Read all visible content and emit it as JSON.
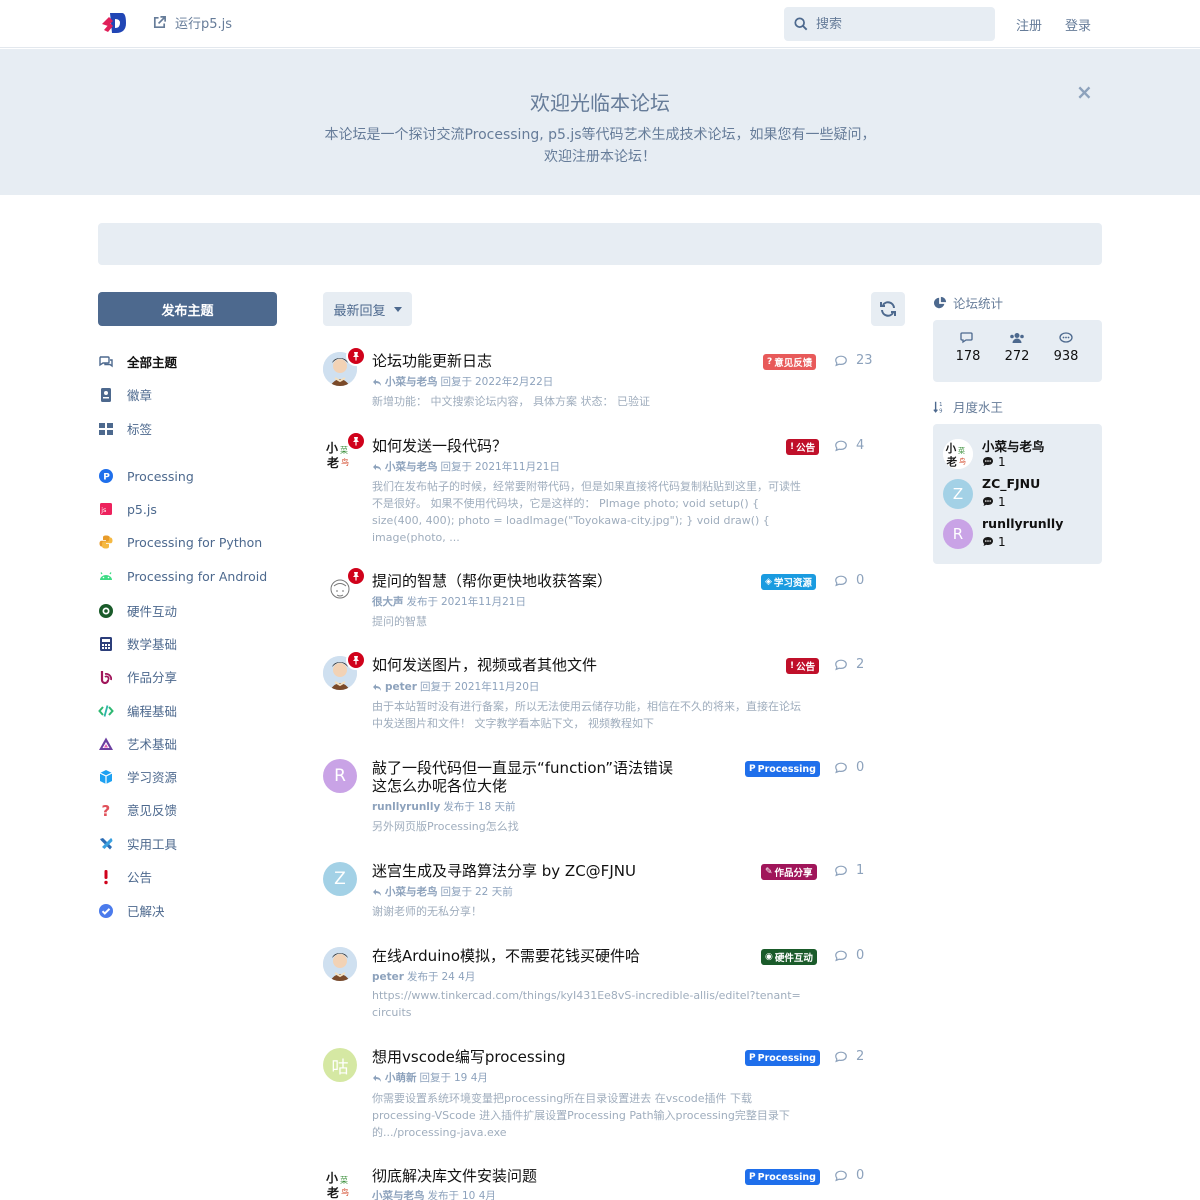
{
  "header": {
    "run_link": "运行p5.js",
    "search_placeholder": "搜索",
    "signup": "注册",
    "login": "登录"
  },
  "hero": {
    "title": "欢迎光临本论坛",
    "description": "本论坛是一个探讨交流Processing, p5.js等代码艺术生成技术论坛，如果您有一些疑问，欢迎注册本论坛！",
    "close_icon": "×"
  },
  "sidebar": {
    "post_button": "发布主题",
    "items": [
      {
        "label": "全部主题",
        "icon": "comments-icon",
        "color": "#4d698e"
      },
      {
        "label": "徽章",
        "icon": "badge-icon",
        "color": "#4d698e"
      },
      {
        "label": "标签",
        "icon": "tags-grid-icon",
        "color": "#4d698e"
      },
      {
        "label": "Processing",
        "icon": "processing-icon",
        "color": "#1f6feb"
      },
      {
        "label": "p5.js",
        "icon": "p5js-icon",
        "color": "#ed225d"
      },
      {
        "label": "Processing for Python",
        "icon": "python-icon",
        "color": "#f0a030"
      },
      {
        "label": "Processing for Android",
        "icon": "android-icon",
        "color": "#3ddc84"
      },
      {
        "label": "硬件互动",
        "icon": "hardware-icon",
        "color": "#1a5b2a"
      },
      {
        "label": "数学基础",
        "icon": "calculator-icon",
        "color": "#2c3e7a"
      },
      {
        "label": "作品分享",
        "icon": "share-icon",
        "color": "#a0155a"
      },
      {
        "label": "编程基础",
        "icon": "code-icon",
        "color": "#2eb872"
      },
      {
        "label": "艺术基础",
        "icon": "art-icon",
        "color": "#6b3fa0"
      },
      {
        "label": "学习资源",
        "icon": "cube-icon",
        "color": "#1da1f2"
      },
      {
        "label": "意见反馈",
        "icon": "question-icon",
        "color": "#e0505a"
      },
      {
        "label": "实用工具",
        "icon": "tools-icon",
        "color": "#2c6db5"
      },
      {
        "label": "公告",
        "icon": "exclamation-icon",
        "color": "#d0021b"
      },
      {
        "label": "已解决",
        "icon": "check-circle-icon",
        "color": "#4b7bec"
      }
    ]
  },
  "toolbar": {
    "sort_label": "最新回复"
  },
  "discussions": [
    {
      "title": "论坛功能更新日志",
      "pinned": true,
      "avatar": "cartoon-avatar",
      "avatar_text": "",
      "avatar_color": "#c9d8e8",
      "reply": true,
      "user": "小菜与老鸟",
      "action": "回复于",
      "time": "2022年2月22日",
      "excerpt": "新增功能： 中文搜索论坛内容， 具体方案 状态： 已验证",
      "tag": {
        "label": "意见反馈",
        "icon": "?",
        "color": "#e85a5a"
      },
      "count": "23"
    },
    {
      "title": "如何发送一段代码？",
      "pinned": true,
      "avatar": "calligraphy-avatar",
      "avatar_text": "",
      "avatar_color": "#ffffff",
      "reply": true,
      "user": "小菜与老鸟",
      "action": "回复于",
      "time": "2021年11月21日",
      "excerpt": "我们在发布帖子的时候，经常要附带代码，但是如果直接将代码复制粘贴到这里，可读性不是很好。 如果不使用代码块，它是这样的： PImage photo; void setup() { size(400, 400); photo = loadImage(\"Toyokawa-city.jpg\"); } void draw() { image(photo, ...",
      "tag": {
        "label": "公告",
        "icon": "!",
        "color": "#c0102a"
      },
      "count": "4"
    },
    {
      "title": "提问的智慧（帮你更快地收获答案）",
      "pinned": true,
      "avatar": "sketch-avatar",
      "avatar_text": "",
      "avatar_color": "#ffffff",
      "reply": false,
      "user": "很大声",
      "action": "发布于",
      "time": "2021年11月21日",
      "excerpt": "提问的智慧",
      "tag": {
        "label": "学习资源",
        "icon": "◈",
        "color": "#1a9be0"
      },
      "count": "0"
    },
    {
      "title": "如何发送图片，视频或者其他文件",
      "pinned": true,
      "avatar": "cartoon-avatar",
      "avatar_text": "",
      "avatar_color": "#c9d8e8",
      "reply": true,
      "user": "peter",
      "action": "回复于",
      "time": "2021年11月20日",
      "excerpt": "由于本站暂时没有进行备案，所以无法使用云储存功能，相信在不久的将来，直接在论坛中发送图片和文件！ 文字教学看本贴下文， 视频教程如下",
      "tag": {
        "label": "公告",
        "icon": "!",
        "color": "#c0102a"
      },
      "count": "2"
    },
    {
      "title": "敲了一段代码但一直显示“function”语法错误这怎么办呢各位大佬",
      "pinned": false,
      "avatar": "letter-avatar",
      "avatar_text": "R",
      "avatar_color": "#c9a3e6",
      "reply": false,
      "user": "runllyrunlly",
      "action": "发布于",
      "time": "18 天前",
      "excerpt": "另外网页版Processing怎么找",
      "tag": {
        "label": "Processing",
        "icon": "P",
        "color": "#1f6feb"
      },
      "count": "0"
    },
    {
      "title": "迷宫生成及寻路算法分享 by ZC@FJNU",
      "pinned": false,
      "avatar": "letter-avatar",
      "avatar_text": "Z",
      "avatar_color": "#a3d1e6",
      "reply": true,
      "user": "小菜与老鸟",
      "action": "回复于",
      "time": "22 天前",
      "excerpt": "谢谢老师的无私分享！",
      "tag": {
        "label": "作品分享",
        "icon": "✎",
        "color": "#a0155a"
      },
      "count": "1"
    },
    {
      "title": "在线Arduino模拟，不需要花钱买硬件哈",
      "pinned": false,
      "avatar": "cartoon-avatar",
      "avatar_text": "",
      "avatar_color": "#c9d8e8",
      "reply": false,
      "user": "peter",
      "action": "发布于",
      "time": "24 4月",
      "excerpt": "https://www.tinkercad.com/things/kyI431Ee8vS-incredible-allis/editel?tenant=circuits",
      "tag": {
        "label": "硬件互动",
        "icon": "◉",
        "color": "#1a5b2a"
      },
      "count": "0"
    },
    {
      "title": "想用vscode编写processing",
      "pinned": false,
      "avatar": "letter-avatar",
      "avatar_text": "咕",
      "avatar_color": "#d5e8a3",
      "reply": true,
      "user": "小萌新",
      "action": "回复于",
      "time": "19 4月",
      "excerpt": "你需要设置系统环境变量把processing所在目录设置进去 在vscode插件 下载processing-VScode 进入插件扩展设置Processing Path输入processing完整目录下的.../processing-java.exe",
      "tag": {
        "label": "Processing",
        "icon": "P",
        "color": "#1f6feb"
      },
      "count": "2"
    },
    {
      "title": "彻底解决库文件安装问题",
      "pinned": false,
      "avatar": "calligraphy-avatar",
      "avatar_text": "",
      "avatar_color": "#ffffff",
      "reply": false,
      "user": "小菜与老鸟",
      "action": "发布于",
      "time": "10 4月",
      "excerpt": "",
      "tag": {
        "label": "Processing",
        "icon": "P",
        "color": "#1f6feb"
      },
      "count": "0"
    }
  ],
  "stats": {
    "title": "论坛统计",
    "discussions": "178",
    "users": "272",
    "posts": "938"
  },
  "monthly_king": {
    "title": "月度水王",
    "users": [
      {
        "name": "小菜与老鸟",
        "avatar": "calligraphy-avatar",
        "avatar_text": "",
        "avatar_color": "#ffffff",
        "count": "1"
      },
      {
        "name": "ZC_FJNU",
        "avatar": "letter-avatar",
        "avatar_text": "Z",
        "avatar_color": "#a3d1e6",
        "count": "1"
      },
      {
        "name": "runllyrunlly",
        "avatar": "letter-avatar",
        "avatar_text": "R",
        "avatar_color": "#c9a3e6",
        "count": "1"
      }
    ]
  }
}
